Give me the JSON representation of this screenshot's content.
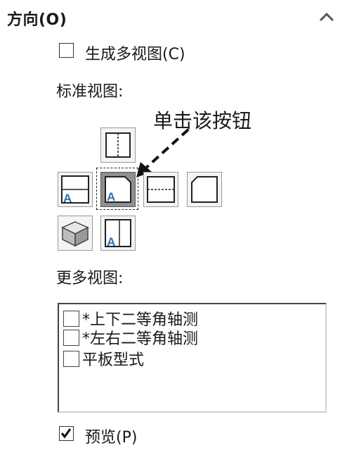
{
  "section": {
    "title": "方向(O)",
    "collapse_icon": "chevron-up-icon"
  },
  "multi_view": {
    "label": "生成多视图(C)",
    "checked": false
  },
  "standard_views": {
    "label": "标准视图:"
  },
  "annotation": {
    "text": "单击该按钮"
  },
  "more_views": {
    "label": "更多视图:",
    "items": [
      {
        "label": "*上下二等角轴测",
        "checked": false
      },
      {
        "label": "*左右二等角轴测",
        "checked": false
      },
      {
        "label": "平板型式",
        "checked": false
      }
    ]
  },
  "preview": {
    "label": "预览(P)",
    "checked": true
  },
  "colors": {
    "accent_blue": "#2f6fb3",
    "selected_bg": "#8f8f8f"
  }
}
